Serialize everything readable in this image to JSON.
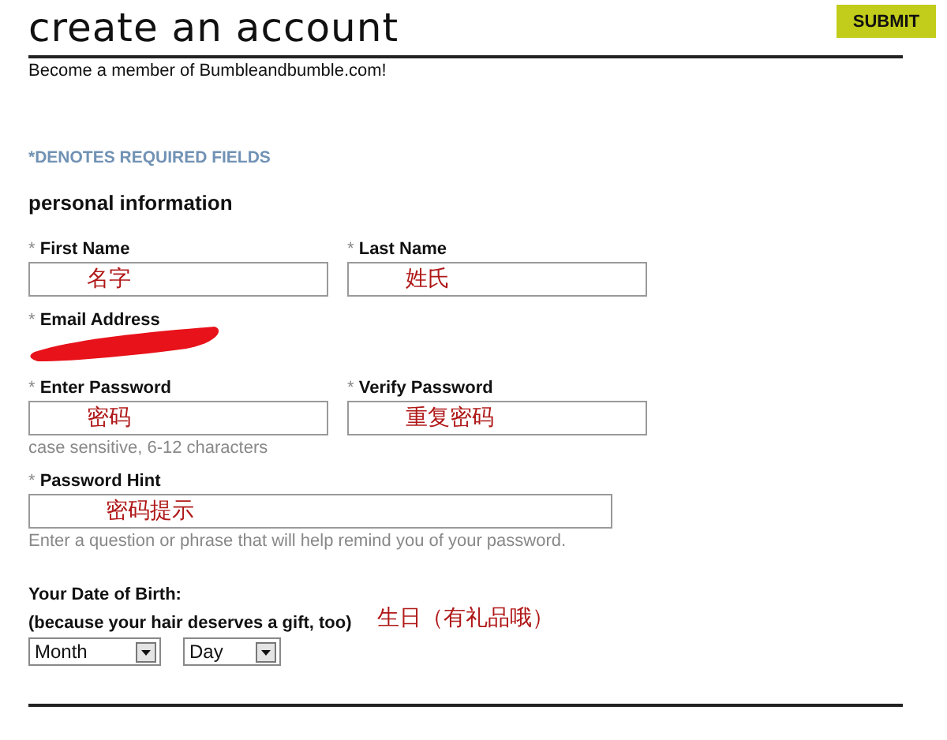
{
  "header": {
    "title": "create an account",
    "subtitle": "Become a member of Bumbleandbumble.com!",
    "submit": "SUBMIT"
  },
  "required_note": "*DENOTES REQUIRED FIELDS",
  "section_title": "personal information",
  "rows": [
    {
      "fields": [
        {
          "label": "First Name",
          "required_mark": "*",
          "value": "名字"
        },
        {
          "label": "Last Name",
          "required_mark": "*",
          "value": "姓氏"
        }
      ]
    },
    {
      "fields": [
        {
          "label": "Email Address",
          "required_mark": "*",
          "redacted": true
        }
      ]
    },
    {
      "fields": [
        {
          "label": "Enter Password",
          "required_mark": "*",
          "value": "密码"
        },
        {
          "label": "Verify Password",
          "required_mark": "*",
          "value": "重复密码"
        }
      ],
      "help": "case sensitive, 6-12 characters"
    },
    {
      "fields": [
        {
          "label": "Password Hint",
          "required_mark": "*",
          "value": "密码提示"
        }
      ],
      "help": "Enter a question or phrase that will help remind you of your password."
    }
  ],
  "birth": {
    "label": "Your Date of Birth:",
    "note": "(because your hair deserves a gift, too)",
    "annotation": "生日（有礼品哦）",
    "selects": [
      {
        "value": "Month"
      },
      {
        "value": "Day"
      }
    ]
  }
}
